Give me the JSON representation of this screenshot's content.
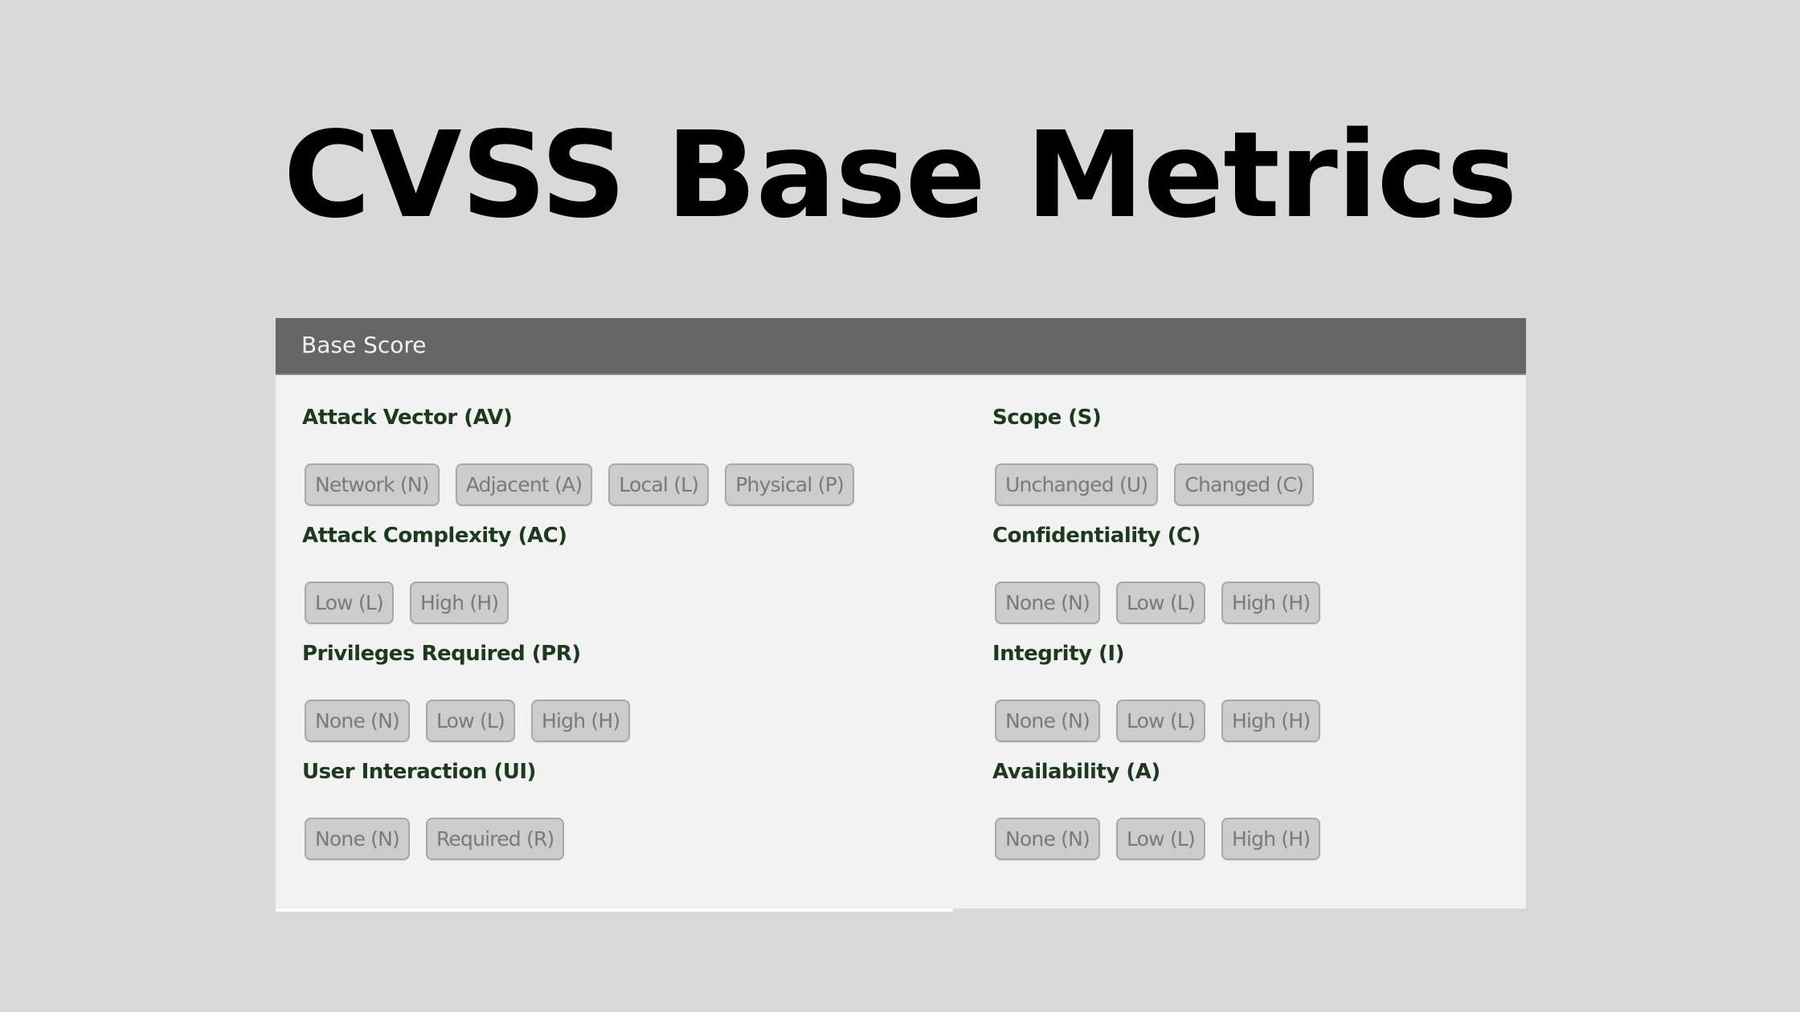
{
  "title": "CVSS Base Metrics",
  "panel": {
    "header": "Base Score",
    "left_metrics": [
      {
        "label": "Attack Vector (AV)",
        "options": [
          "Network (N)",
          "Adjacent (A)",
          "Local (L)",
          "Physical (P)"
        ]
      },
      {
        "label": "Attack Complexity (AC)",
        "options": [
          "Low (L)",
          "High (H)"
        ]
      },
      {
        "label": "Privileges Required (PR)",
        "options": [
          "None (N)",
          "Low (L)",
          "High (H)"
        ]
      },
      {
        "label": "User Interaction (UI)",
        "options": [
          "None (N)",
          "Required (R)"
        ]
      }
    ],
    "right_metrics": [
      {
        "label": "Scope (S)",
        "options": [
          "Unchanged (U)",
          "Changed (C)"
        ]
      },
      {
        "label": "Confidentiality (C)",
        "options": [
          "None (N)",
          "Low (L)",
          "High (H)"
        ]
      },
      {
        "label": "Integrity (I)",
        "options": [
          "None (N)",
          "Low (L)",
          "High (H)"
        ]
      },
      {
        "label": "Availability (A)",
        "options": [
          "None (N)",
          "Low (L)",
          "High (H)"
        ]
      }
    ]
  },
  "colors": {
    "background": "#d9d9d9",
    "header_bg": "#666666",
    "panel_bg": "#f2f2f2",
    "heading_text": "#1e3a1e",
    "button_bg": "#cccccc",
    "button_text": "#7a7a7a"
  }
}
